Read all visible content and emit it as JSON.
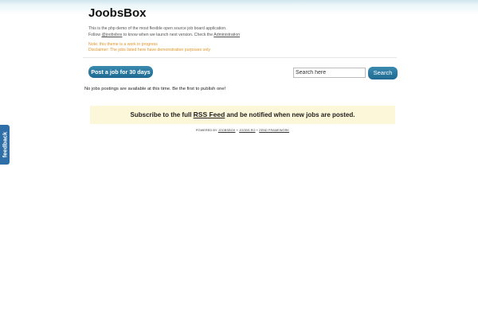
{
  "site": {
    "title": "JoobsBox"
  },
  "intro": {
    "line1": "This is the php demo of the most flexible open source job board application.",
    "line2_prefix": "Follow ",
    "follow_link": "@joobsbox",
    "line2_middle": " to know when we launch next version. Check the ",
    "admin_link": "Administration"
  },
  "notes": {
    "note": "Note: this theme is a work in progress",
    "disclaimer": "Disclaimer: The jobs listed here have demonstration purposes only"
  },
  "toolbar": {
    "post_label": "Post a job for 30 days",
    "search_placeholder": "Search here",
    "search_label": "Search"
  },
  "main": {
    "no_jobs": "No jobs postings are available at this time. Be the first to publish one!"
  },
  "subscribe": {
    "prefix": "Subscribe to the full ",
    "link": "RSS Feed",
    "suffix": " and be notified when new jobs are posted."
  },
  "footer": {
    "powered_by": "POWERED BY ",
    "link1": "JOOBSBOX",
    "sep1": " + ",
    "link2": "JOOBS.RO",
    "sep2": " + ",
    "link3": "ZEND FRAMEWORK"
  },
  "feedback": {
    "label": "feedback"
  },
  "colors": {
    "accent": "#1f6a92",
    "note": "#e0962b",
    "subscribe_bg": "#fdf7d9",
    "feedback_tab": "#2f6fa8"
  }
}
